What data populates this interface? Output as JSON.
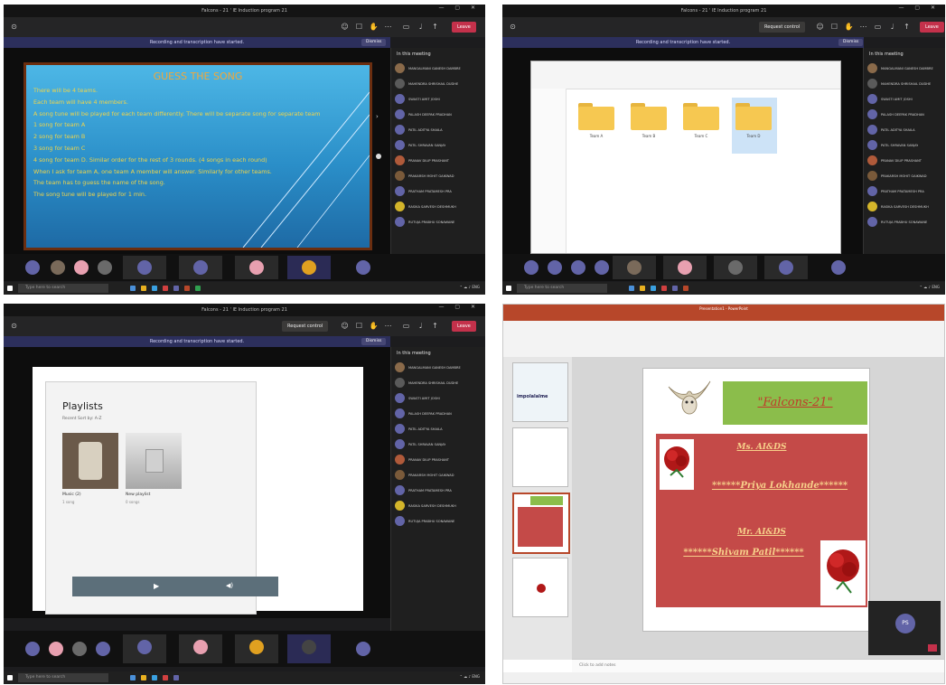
{
  "colors": {
    "teams_dark": "#1c1c1e",
    "leave_red": "#c4314b",
    "notice_purple": "#2c2f5c",
    "slide_blue": "#2a8ec8",
    "slide_text": "#f0d44a",
    "ppt_accent": "#b7472a",
    "falcons_green": "#8bbd4b",
    "red_box": "#c44a48"
  },
  "common": {
    "window_title": "Falcons - 21 ' IE Induction program 21",
    "leave": "Leave",
    "request_control": "Request control",
    "recording_notice": "Recording and transcription have started.",
    "dismiss": "Dismiss",
    "in_this_meeting": "In this meeting",
    "search": "Type here to search"
  },
  "participants": [
    {
      "name": "MANGALMANI GANESH DAMBRE",
      "color": "#8a6a4a"
    },
    {
      "name": "MAHENDRA SHRISHAIL DUDHE",
      "color": "#5a5a5a"
    },
    {
      "name": "SWASTI AMIT JOSHI",
      "color": "#6264a7"
    },
    {
      "name": "PALASH DEEPAK PRADHAN",
      "color": "#6264a7"
    },
    {
      "name": "PATIL ADITYA SHAILA",
      "color": "#6264a7"
    },
    {
      "name": "PATIL SHRAVAN SANJAY",
      "color": "#6264a7"
    },
    {
      "name": "PRANAV DILIP PRASHANT",
      "color": "#b05a3a"
    },
    {
      "name": "PRAKARSH MOHIT GAIKWAD",
      "color": "#7a5a3a"
    },
    {
      "name": "PRATHAM PRATAMESH PRA",
      "color": "#6264a7"
    },
    {
      "name": "RASIKA SARVESH DESHMUKH",
      "color": "#d4b52a"
    },
    {
      "name": "RUTUJA PRABHU SONAWANE",
      "color": "#6264a7"
    }
  ],
  "slide": {
    "title": "GUESS THE SONG",
    "lines": [
      "There will be 4 teams.",
      "Each team will have 4 members.",
      "A song tune will be played for each team differently. There will be separate song for separate team",
      "1 song for team A",
      "2 song for team B",
      "3 song for team C",
      "4 song for team D. Similar order for the rest of 3 rounds. (4 songs in each round)",
      "When I ask for team A, one team A member will answer. Similarly for other teams.",
      "The team has to guess the name of the song.",
      "The song tune will be played for 1 min."
    ]
  },
  "explorer": {
    "folders": [
      "Team A",
      "Team B",
      "Team C",
      "Team D"
    ]
  },
  "groove": {
    "title": "Playlists",
    "subtitle": "Recent   Sort by: A-Z",
    "cards": [
      {
        "name": "Music (2)",
        "sub": "1 song"
      },
      {
        "name": "New playlist",
        "sub": "0 songs"
      }
    ]
  },
  "ppt": {
    "window_title": "Presentation1 - PowerPoint",
    "heading": "\"Falcons-21\"",
    "name1_label": "Ms. AI&DS",
    "name1": "******Priya Lokhande******",
    "name2_label": "Mr. AI&DS",
    "name2": "******Shivam Patil******",
    "notes": "Click to add notes",
    "thumb_label": "impolalalme",
    "mini_initials": "PS"
  }
}
